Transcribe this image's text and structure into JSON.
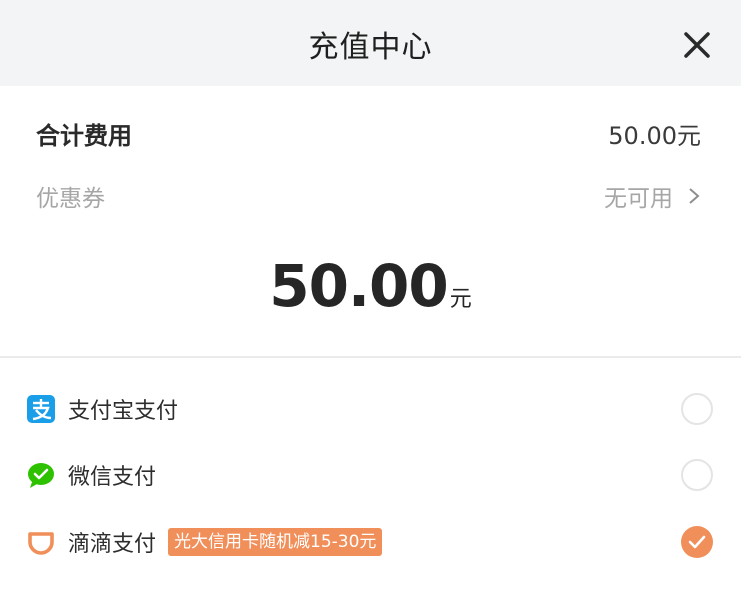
{
  "header": {
    "title": "充值中心"
  },
  "summary": {
    "total_label": "合计费用",
    "total_value": "50.00元",
    "coupon_label": "优惠券",
    "coupon_value": "无可用"
  },
  "amount": {
    "value": "50.00",
    "unit": "元"
  },
  "payment_methods": [
    {
      "label": "支付宝支付",
      "icon": "alipay-icon",
      "selected": false
    },
    {
      "label": "微信支付",
      "icon": "wechat-pay-icon",
      "selected": false
    },
    {
      "label": "滴滴支付",
      "icon": "didi-pay-icon",
      "promo": "光大信用卡随机减15-30元",
      "selected": true
    }
  ],
  "colors": {
    "accent": "#f08f5a",
    "alipay": "#1a9ee8",
    "wechat": "#2dc100",
    "didi": "#f08f5a"
  }
}
